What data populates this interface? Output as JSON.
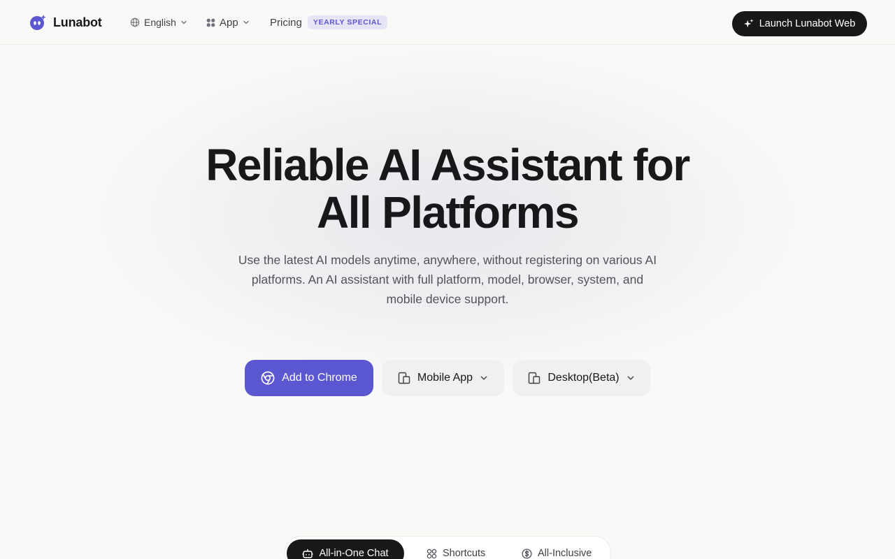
{
  "header": {
    "brand": "Lunabot",
    "nav": {
      "language": "English",
      "app": "App",
      "pricing": "Pricing",
      "pricing_badge": "YEARLY SPECIAL"
    },
    "launch_button": "Launch Lunabot Web"
  },
  "hero": {
    "title_line1": "Reliable AI Assistant for",
    "title_line2": "All Platforms",
    "subtitle": "Use the latest AI models anytime, anywhere, without registering on various AI platforms. An AI assistant with full platform, model, browser, system, and mobile device support.",
    "cta": {
      "chrome": "Add to Chrome",
      "mobile": "Mobile App",
      "desktop": "Desktop(Beta)"
    }
  },
  "feature_tabs": [
    {
      "label": "All-in-One Chat",
      "icon": "robot-icon",
      "active": true
    },
    {
      "label": "Shortcuts",
      "icon": "grid-shortcuts-icon",
      "active": false
    },
    {
      "label": "All-Inclusive",
      "icon": "dollar-coin-icon",
      "active": false
    }
  ],
  "colors": {
    "accent": "#5b57d1",
    "badge_text": "#5b57c9",
    "badge_bg": "#e6e5f6",
    "dark": "#18181b",
    "background": "#f9f9f7"
  }
}
